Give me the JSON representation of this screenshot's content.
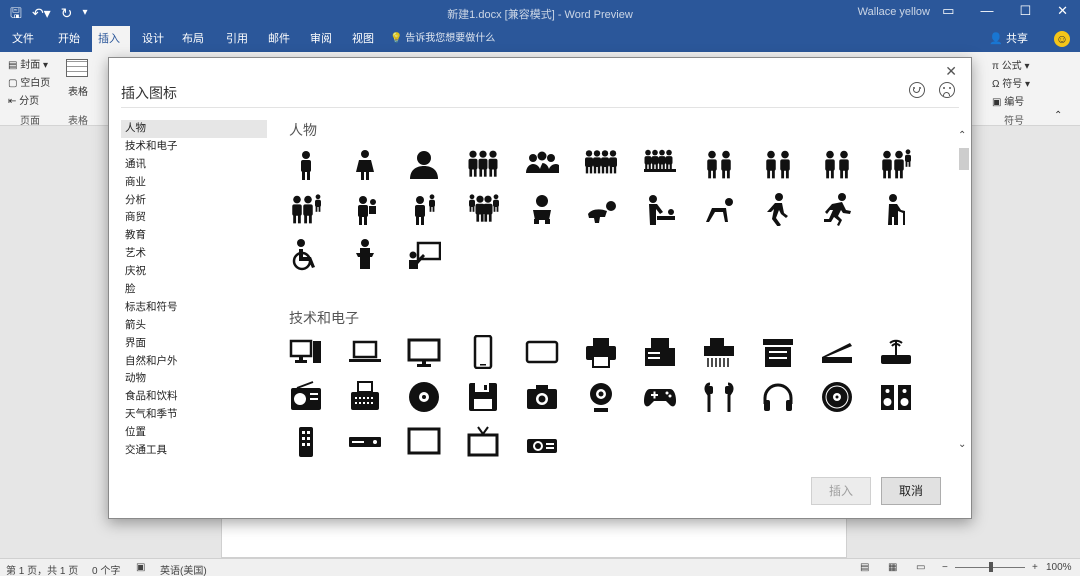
{
  "titlebar": {
    "doc_title": "新建1.docx [兼容模式] - Word Preview",
    "user": "Wallace yellow",
    "qat": {
      "save_icon": "save-icon",
      "undo_icon": "undo-icon",
      "redo_icon": "redo-icon"
    },
    "controls": {
      "restore": "▭",
      "minimize": "—",
      "maximize": "☐",
      "close": "✕"
    }
  },
  "tabs": [
    "文件",
    "开始",
    "插入",
    "设计",
    "布局",
    "引用",
    "邮件",
    "审阅",
    "视图"
  ],
  "active_tab": "插入",
  "tell_me": "告诉我您想要做什么",
  "share": "共享",
  "ribbon": {
    "pages": [
      "封面",
      "空白页",
      "分页"
    ],
    "pages_group": "页面",
    "table_btn": "表格",
    "tables_group": "表格",
    "formula": "公式",
    "symbol": "符号",
    "number": "编号",
    "symbols_group": "符号"
  },
  "dialog": {
    "title": "插入图标",
    "close": "✕",
    "categories": [
      "人物",
      "技术和电子",
      "通讯",
      "商业",
      "分析",
      "商贸",
      "教育",
      "艺术",
      "庆祝",
      "脸",
      "标志和符号",
      "箭头",
      "界面",
      "自然和户外",
      "动物",
      "食品和饮料",
      "天气和季节",
      "位置",
      "交通工具"
    ],
    "selected_category": "人物",
    "sections": [
      {
        "title": "人物",
        "icons": [
          "man-icon",
          "woman-icon",
          "user-icon",
          "group-of-three-icon",
          "meeting-group-icon",
          "group-of-four-icon",
          "crowd-icon",
          "two-women-icon",
          "two-women-alt-icon",
          "two-men-icon",
          "family-icon",
          "family-with-child-icon",
          "parent-holding-child-icon",
          "adult-with-child-icon",
          "family-of-four-icon",
          "baby-icon",
          "crawling-baby-icon",
          "changing-table-icon",
          "crawling-person-icon",
          "walking-person-icon",
          "running-person-icon",
          "elderly-person-icon",
          "wheelchair-icon",
          "speaker-at-podium-icon",
          "presenter-at-board-icon"
        ]
      },
      {
        "title": "技术和电子",
        "icons": [
          "desktop-computer-icon",
          "laptop-icon",
          "monitor-icon",
          "smartphone-icon",
          "tablet-icon",
          "printer-icon",
          "fax-printer-icon",
          "paper-shredder-icon",
          "copier-icon",
          "scanner-icon",
          "router-icon",
          "radio-icon",
          "typewriter-icon",
          "cd-disc-icon",
          "floppy-disk-icon",
          "camera-icon",
          "webcam-icon",
          "gamepad-icon",
          "earbuds-icon",
          "headphones-icon",
          "vinyl-record-icon",
          "speakers-icon",
          "remote-control-icon",
          "dvd-player-icon",
          "tv-icon",
          "old-tv-icon",
          "projector-icon"
        ]
      }
    ],
    "insert_button": "插入",
    "cancel_button": "取消"
  },
  "status": {
    "page": "第 1 页，共 1 页",
    "words": "0 个字",
    "language": "英语(美国)",
    "zoom": "100%",
    "zoom_minus": "−",
    "zoom_plus": "+"
  }
}
